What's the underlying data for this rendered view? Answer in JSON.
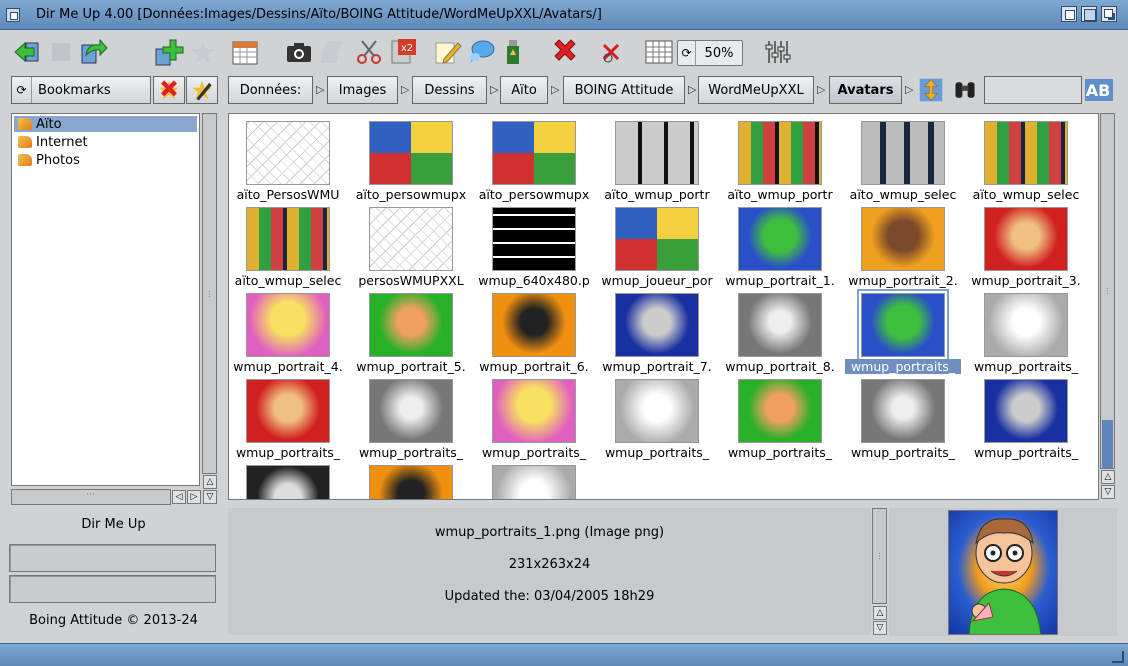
{
  "window": {
    "title": "Dir Me Up 4.00 [Données:Images/Dessins/Aïto/BOING Attitude/WordMeUpXXL/Avatars/]"
  },
  "toolbar": {
    "zoom_percent": "50%",
    "icons": [
      "back-arrow-icon",
      "disabled-icon",
      "forward-arrow-icon",
      "add-bookmark-icon",
      "star-icon",
      "calendar-icon",
      "camera-icon",
      "blank-icon",
      "scissors-icon",
      "x2-icon",
      "pencil-icon",
      "chat-bubble-icon",
      "usb-icon",
      "delete-icon",
      "cancel-x-icon",
      "grid-view-icon",
      "zoom-cycle-icon",
      "settings-sliders-icon"
    ]
  },
  "bookmarks": {
    "selector_label": "Bookmarks",
    "items": [
      {
        "label": "Aïto",
        "selected": true
      },
      {
        "label": "Internet",
        "selected": false
      },
      {
        "label": "Photos",
        "selected": false
      }
    ]
  },
  "breadcrumb": [
    "Données:",
    "Images",
    "Dessins",
    "Aïto",
    "BOING Attitude",
    "WordMeUpXXL",
    "Avatars"
  ],
  "thumbnails": [
    {
      "name": "aïto_PersosWMU",
      "style": "sketch"
    },
    {
      "name": "aïto_persowmupx",
      "style": "colorgrid"
    },
    {
      "name": "aïto_persowmupx",
      "style": "colorgrid"
    },
    {
      "name": "aïto_wmup_portr",
      "style": "darkgrid"
    },
    {
      "name": "aïto_wmup_portr",
      "style": "darkcolor"
    },
    {
      "name": "aïto_wmup_selec",
      "style": "bluegray"
    },
    {
      "name": "aïto_wmup_selec",
      "style": "bluecolor"
    },
    {
      "name": "aïto_wmup_selec",
      "style": "bluecolor"
    },
    {
      "name": "persosWMUPXXL",
      "style": "sketch"
    },
    {
      "name": "wmup_640x480.p",
      "style": "wtext"
    },
    {
      "name": "wmup_joueur_por",
      "style": "colorgrid"
    },
    {
      "name": "wmup_portrait_1.",
      "style": "green-blue"
    },
    {
      "name": "wmup_portrait_2.",
      "style": "orange"
    },
    {
      "name": "wmup_portrait_3.",
      "style": "red"
    },
    {
      "name": "wmup_portrait_4.",
      "style": "pink"
    },
    {
      "name": "wmup_portrait_5.",
      "style": "green"
    },
    {
      "name": "wmup_portrait_6.",
      "style": "orange2"
    },
    {
      "name": "wmup_portrait_7.",
      "style": "blue"
    },
    {
      "name": "wmup_portrait_8.",
      "style": "gray"
    },
    {
      "name": "wmup_portraits_",
      "style": "green-blue",
      "selected": true
    },
    {
      "name": "wmup_portraits_",
      "style": "gray-light"
    },
    {
      "name": "wmup_portraits_",
      "style": "red"
    },
    {
      "name": "wmup_portraits_",
      "style": "gray"
    },
    {
      "name": "wmup_portraits_",
      "style": "pink"
    },
    {
      "name": "wmup_portraits_",
      "style": "gray-light"
    },
    {
      "name": "wmup_portraits_",
      "style": "green"
    },
    {
      "name": "wmup_portraits_",
      "style": "gray"
    },
    {
      "name": "wmup_portraits_",
      "style": "blue"
    },
    {
      "name": "",
      "style": "dark"
    },
    {
      "name": "",
      "style": "orange2"
    },
    {
      "name": "",
      "style": "gray-light"
    }
  ],
  "left_panel": {
    "app_name": "Dir Me Up",
    "copyright": "Boing Attitude © 2013-24"
  },
  "preview": {
    "filename": "wmup_portraits_1.png (Image png)",
    "dimensions": "231x263x24",
    "updated": "Updated the: 03/04/2005 18h29"
  },
  "colors": {
    "titlebar": "#6f98c5",
    "selection": "#6e8fbf",
    "panel": "#cfd3d6"
  }
}
